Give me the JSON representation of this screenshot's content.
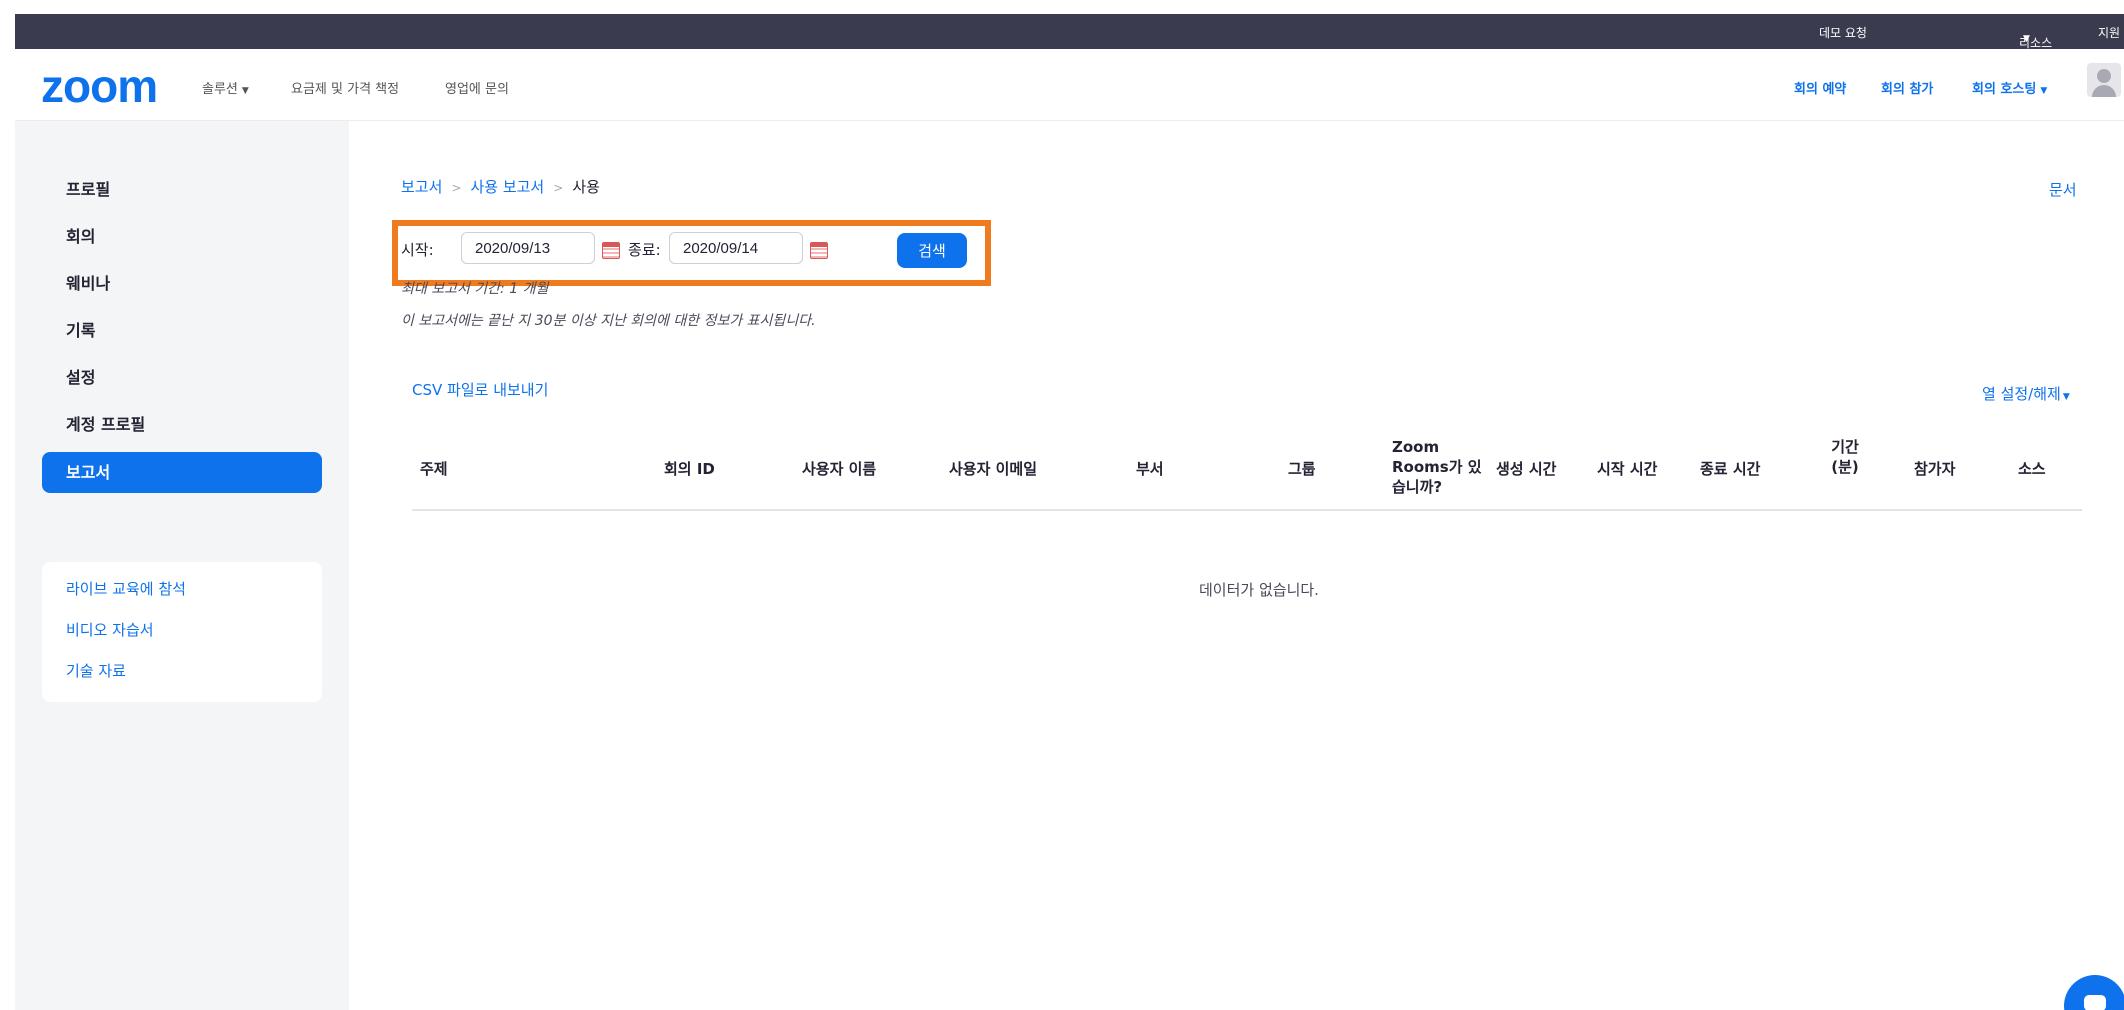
{
  "topbar": {
    "demo_request": "데모 요청",
    "resources": "리소스",
    "support": "지원"
  },
  "header": {
    "logo": "zoom",
    "nav": {
      "solutions": "솔루션",
      "plans_pricing": "요금제 및 가격 책정",
      "contact_sales": "영업에 문의"
    },
    "actions": {
      "schedule": "회의 예약",
      "join": "회의 참가",
      "host": "회의 호스팅"
    }
  },
  "sidebar": {
    "items": [
      {
        "label": "프로필"
      },
      {
        "label": "회의"
      },
      {
        "label": "웨비나"
      },
      {
        "label": "기록"
      },
      {
        "label": "설정"
      },
      {
        "label": "계정 프로필"
      },
      {
        "label": "보고서",
        "active": true
      }
    ],
    "support_links": [
      {
        "label": "라이브 교육에 참석"
      },
      {
        "label": "비디오 자습서"
      },
      {
        "label": "기술 자료"
      }
    ]
  },
  "breadcrumb": {
    "reports": "보고서",
    "usage_reports": "사용 보고서",
    "current": "사용",
    "separator": ">"
  },
  "doc_link": "문서",
  "filters": {
    "start_label": "시작:",
    "start_value": "2020/09/13",
    "end_label": "종료:",
    "end_value": "2020/09/14",
    "search_label": "검색"
  },
  "notes": {
    "max_period": "최대 보고서 기간: 1 개월",
    "info": "이 보고서에는 끝난 지 30분 이상 지난 회의에 대한 정보가 표시됩니다."
  },
  "csv_export": "CSV 파일로 내보내기",
  "column_toggle": "열 설정/해제",
  "table": {
    "columns": [
      "주제",
      "회의 ID",
      "사용자 이름",
      "사용자 이메일",
      "부서",
      "그룹",
      "Zoom Rooms가 있습니까?",
      "생성 시간",
      "시작 시간",
      "종료 시간",
      "기간 (분)",
      "참가자",
      "소스"
    ],
    "rows": [],
    "empty_message": "데이터가 없습니다."
  },
  "colors": {
    "accent": "#0e72ed",
    "topbar": "#3b3b4f",
    "highlight": "#f07b1f",
    "sidebar_bg": "#f4f5f7"
  },
  "icons": {
    "calendar": "calendar-icon",
    "chat": "chat-icon",
    "avatar": "user-avatar-icon"
  }
}
